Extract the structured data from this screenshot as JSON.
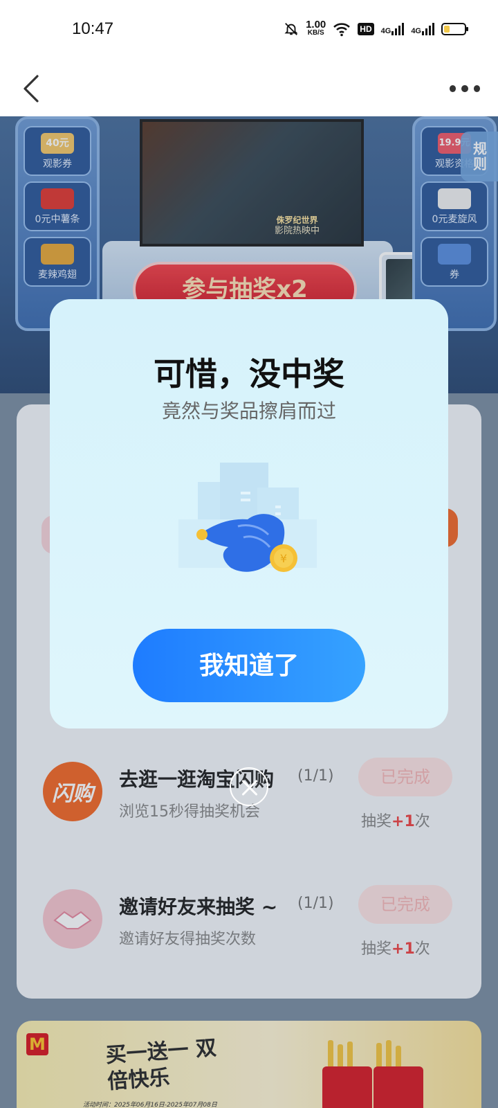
{
  "status_bar": {
    "time": "10:47",
    "speed_value": "1.00",
    "speed_unit": "KB/S",
    "hd": "HD",
    "net1": "4G",
    "net2": "4G"
  },
  "banner": {
    "left_prizes": [
      "观影券",
      "0元中薯条",
      "麦辣鸡翅"
    ],
    "left_badge": "40元",
    "right_prizes": [
      "观影资格",
      "0元麦旋风",
      "券"
    ],
    "right_badge": "19.9元",
    "screen_badge_title": "侏罗纪世界",
    "screen_badge_text": "影院热映中",
    "draw_label": "参与抽奖x2",
    "rules_label": "规则"
  },
  "tasks": [
    {
      "icon_text": "闪购",
      "title": "去逛一逛淘宝闪购",
      "progress": "(1/1)",
      "desc": "浏览15秒得抽奖机会",
      "button": "已完成",
      "reward_prefix": "抽奖",
      "reward_plus": "+1",
      "reward_suffix": "次"
    },
    {
      "icon_text": "",
      "title": "邀请好友来抽奖 ~",
      "progress": "(1/1)",
      "desc": "邀请好友得抽奖次数",
      "button": "已完成",
      "reward_prefix": "抽奖",
      "reward_plus": "+1",
      "reward_suffix": "次"
    }
  ],
  "promo": {
    "logo": "M",
    "title": "买一送一 双倍快乐",
    "date": "活动时间：2025年06月16日-2025年07月08日"
  },
  "modal": {
    "title": "可惜，没中奖",
    "subtitle": "竟然与奖品擦肩而过",
    "button": "我知道了",
    "coin_symbol": "¥"
  },
  "colors": {
    "primary": "#1e7cff",
    "danger": "#f04545"
  }
}
